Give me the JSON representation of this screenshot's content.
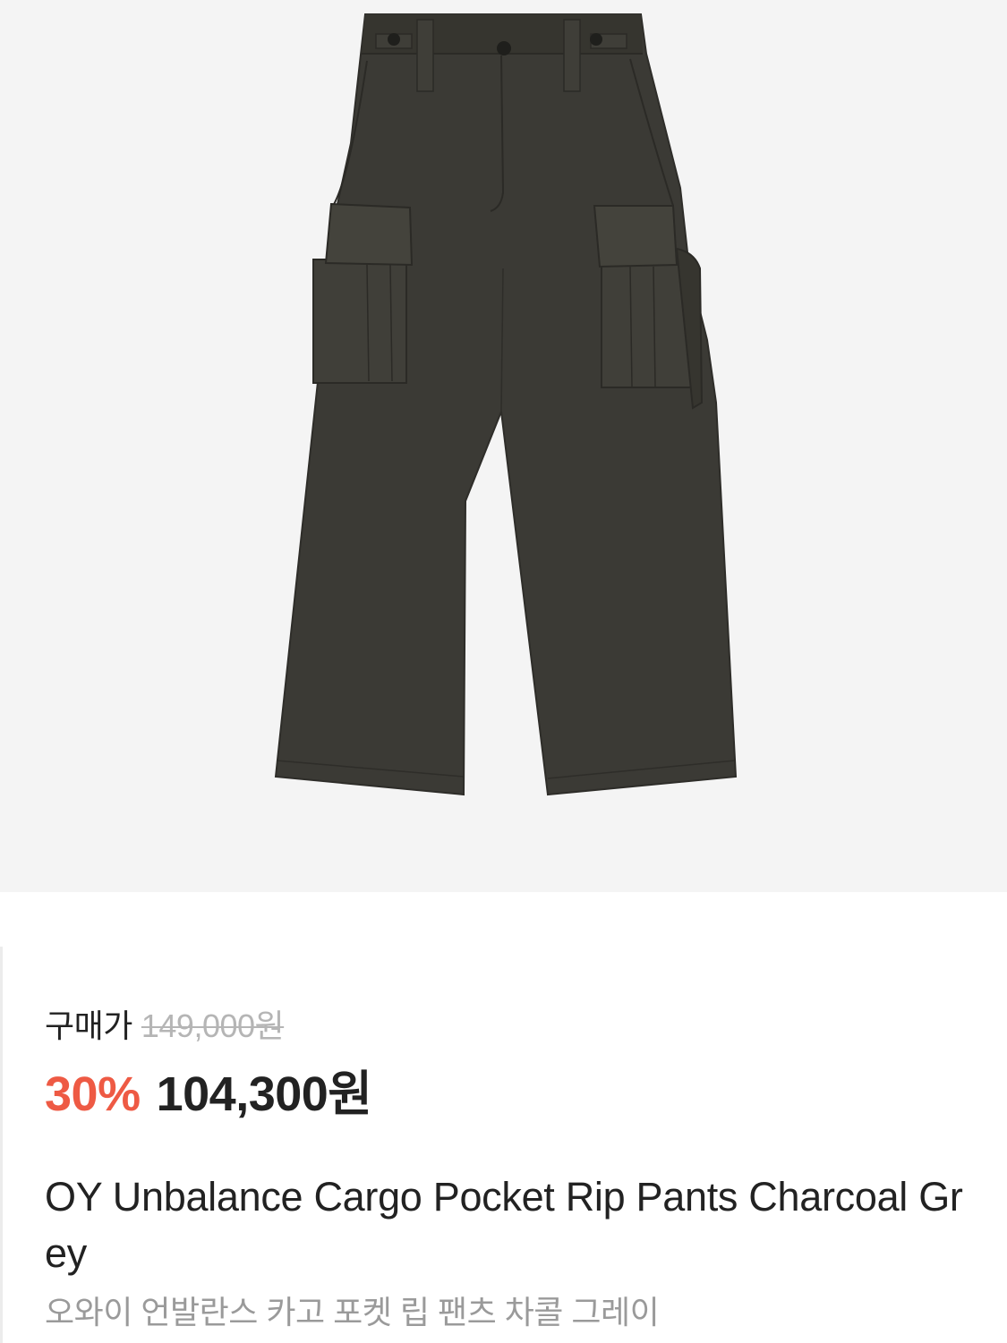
{
  "product": {
    "image_alt_icon": "cargo-pants-image",
    "purchase_label": "구매가",
    "original_price": "149,000원",
    "discount": "30%",
    "sale_price": "104,300원",
    "title": "OY Unbalance Cargo Pocket Rip Pants Charcoal Grey",
    "subtitle": "오와이 언발란스 카고 포켓 립 팬츠 차콜 그레이"
  },
  "colors": {
    "image_background": "#f4f4f4",
    "pants": "#3b3a35",
    "discount": "#ee5a44",
    "strike_price": "#b5b5b5",
    "subtitle": "#9a9a9a"
  }
}
